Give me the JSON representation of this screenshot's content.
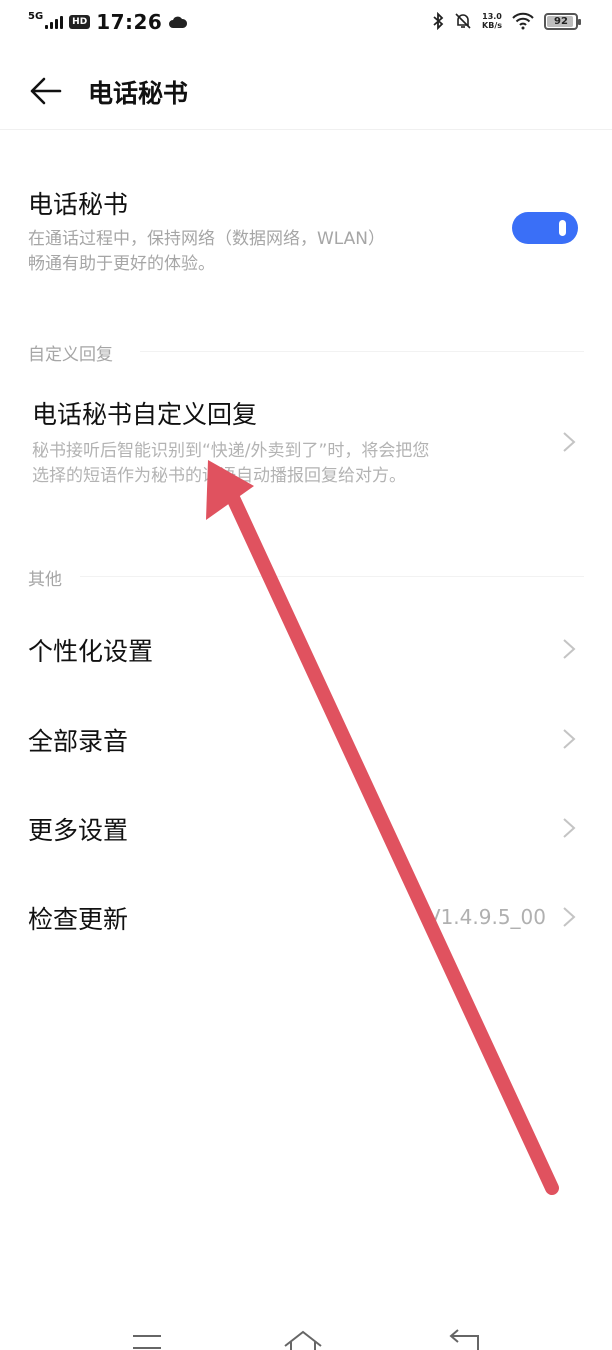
{
  "status_bar": {
    "network": "5G",
    "hd": "HD",
    "time": "17:26",
    "speed_value": "13.0",
    "speed_unit": "KB/s",
    "battery": "92",
    "battery_level": 0.92
  },
  "header": {
    "title": "电话秘书"
  },
  "secretary": {
    "title": "电话秘书",
    "desc_line1": "在通话过程中，保持网络（数据网络，WLAN）",
    "desc_line2": "畅通有助于更好的体验。",
    "enabled": true,
    "accent_color": "#3a6ff7"
  },
  "section_custom": {
    "label": "自定义回复"
  },
  "custom_reply": {
    "title": "电话秘书自定义回复",
    "desc_line1": "秘书接听后智能识别到“快递/外卖到了”时，将会把您",
    "desc_line2": "选择的短语作为秘书的话语自动播报回复给对方。"
  },
  "section_other": {
    "label": "其他"
  },
  "other_items": [
    {
      "label": "个性化设置"
    },
    {
      "label": "全部录音"
    },
    {
      "label": "更多设置"
    },
    {
      "label": "检查更新",
      "value": "V1.4.9.5_00"
    }
  ],
  "annotation": {
    "color": "#e0525f"
  }
}
